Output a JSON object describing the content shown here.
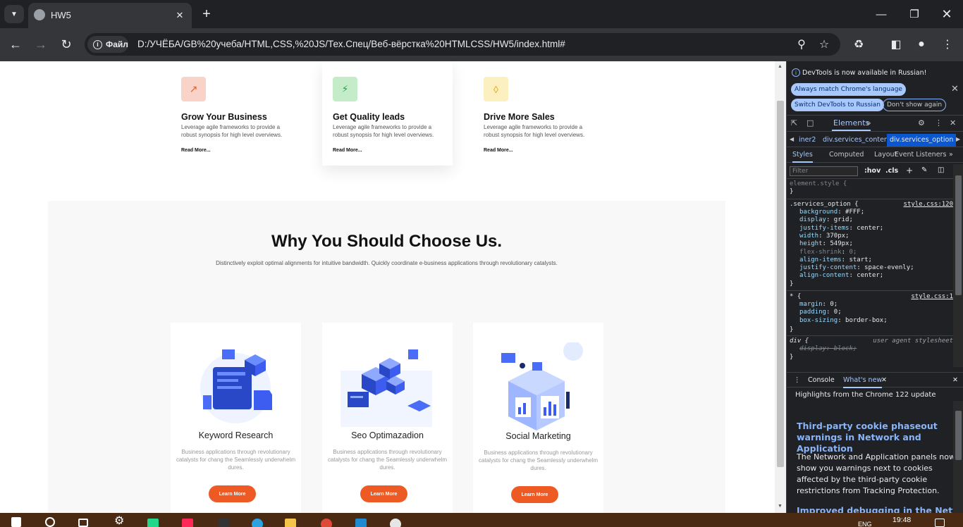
{
  "browser": {
    "tab_title": "HW5",
    "address_chip": "Файл",
    "url": "D:/УЧЁБА/GB%20учеба/HTML,CSS,%20JS/Тех.Спец/Веб-вёрстка%20HTMLCSS/HW5/index.html#"
  },
  "page": {
    "services": [
      {
        "title": "Grow Your Business",
        "text": "Leverage agile frameworks to provide a robust synopsis for high level overviews.",
        "link": "Read More...",
        "icon": "chart-icon",
        "icon_color": "#f9d3c8"
      },
      {
        "title": "Get Quality leads",
        "text": "Leverage agile frameworks to provide a robust synopsis for high level overviews.",
        "link": "Read More...",
        "icon": "bolt-icon",
        "icon_color": "#c5ecc8"
      },
      {
        "title": "Drive More Sales",
        "text": "Leverage agile frameworks to provide a robust synopsis for high level overviews.",
        "link": "Read More...",
        "icon": "tag-icon",
        "icon_color": "#fcefc0"
      }
    ],
    "why": {
      "title": "Why You Should Choose Us.",
      "subtitle": "Distinctively exploit optimal alignments for intuitive bandwidth. Quickly coordinate e-business applications through revolutionary catalysts."
    },
    "options": [
      {
        "title": "Keyword Research",
        "text": "Business applications through revolutionary catalysts for chang the Seamlessly underwhelm dures.",
        "button": "Learn More"
      },
      {
        "title": "Seo Optimazadion",
        "text": "Business applications through revolutionary catalysts for chang the Seamlessly underwhelm dures.",
        "button": "Learn More"
      },
      {
        "title": "Social Marketing",
        "text": "Business applications through revolutionary catalysts for chang the Seamlessly underwhelm dures.",
        "button": "Learn More"
      }
    ],
    "accent_color": "#ee5a24"
  },
  "devtools": {
    "banner_text": "DevTools is now available in Russian!",
    "banner_btn_1": "Always match Chrome's language",
    "banner_btn_2": "Switch DevTools to Russian",
    "banner_btn_3": "Don't show again",
    "main_tab": "Elements",
    "crumbs": [
      "iner2",
      "div.services_content",
      "div.services_option"
    ],
    "sub_tabs": [
      "Styles",
      "Computed",
      "Layout",
      "Event Listeners"
    ],
    "filter_placeholder": "Filter",
    "hov": ":hov",
    "cls": ".cls",
    "styles": {
      "element_style": "element.style {",
      "close": "}",
      "rule1_selector": ".services_option {",
      "rule1_source": "style.css:120",
      "rule1_props": [
        {
          "name": "background",
          "value": "#FFF;"
        },
        {
          "name": "display",
          "value": "grid;"
        },
        {
          "name": "justify-items",
          "value": "center;"
        },
        {
          "name": "width",
          "value": "370px;"
        },
        {
          "name": "height",
          "value": "549px;"
        },
        {
          "name": "flex-shrink",
          "value": "0;"
        },
        {
          "name": "align-items",
          "value": "start;"
        },
        {
          "name": "justify-content",
          "value": "space-evenly;"
        },
        {
          "name": "align-content",
          "value": "center;"
        }
      ],
      "rule2_selector": "* {",
      "rule2_source": "style.css:1",
      "rule2_props": [
        {
          "name": "margin",
          "value": "0;"
        },
        {
          "name": "padding",
          "value": "0;"
        },
        {
          "name": "box-sizing",
          "value": "border-box;"
        }
      ],
      "rule3_selector": "div {",
      "rule3_source": "user agent stylesheet",
      "rule3_prop": "display: block;"
    },
    "drawer_tabs": [
      "Console",
      "What's new"
    ],
    "drawer_highlight": "Highlights from the Chrome 122 update",
    "drawer_heading": "Third-party cookie phaseout warnings in Network and Application",
    "drawer_text": "The Network and Application panels now show you warnings next to cookies affected by the third-party cookie restrictions from Tracking Protection.",
    "drawer_heading_2": "Improved debugging in the Network"
  },
  "taskbar": {
    "lang": "ENG",
    "time": "19:48"
  }
}
